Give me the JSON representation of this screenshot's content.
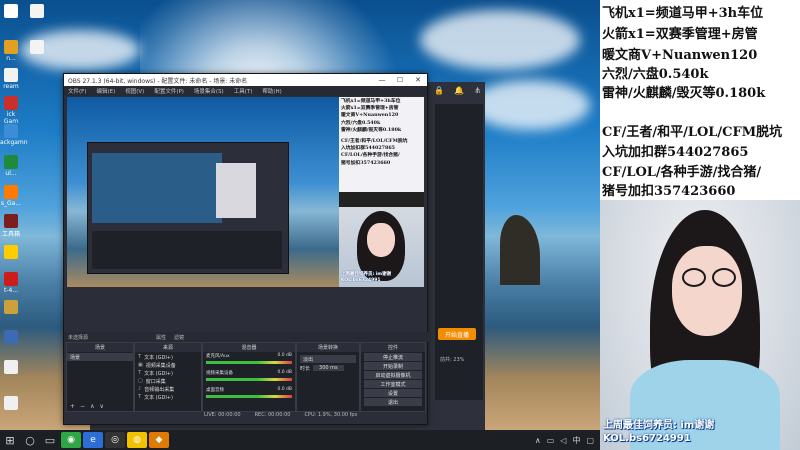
{
  "desktop": {
    "icons": [
      "n...",
      "ream",
      "ick Gam",
      "ackgamn",
      "ul...",
      "s_Ga...",
      "t-4...",
      "工具箱"
    ],
    "icons_right": [
      "",
      "",
      "",
      "",
      "",
      "",
      ""
    ]
  },
  "obs": {
    "title": "OBS 27.1.3 (64-bit, windows) - 配置文件: 未命名 - 场景: 未命名",
    "menu": [
      "文件(F)",
      "编辑(E)",
      "视图(V)",
      "配置文件(P)",
      "场景集合(S)",
      "工具(T)",
      "帮助(H)"
    ],
    "preview_text": [
      "飞机x1=频道马甲+3h车位",
      "火箭x1=双赛季管理+房管",
      "暖文商V+Nuanwen120",
      "六烈/六盘0.540k",
      "雷神/火麒麟/毁灭等0.180k",
      "CF/王者/和平/LOL/CFM脱坑",
      "入坑加扣群544027865",
      "CF/LOL/各种手游/找合猪/",
      "猪号加扣357423660"
    ],
    "preview_caption": "上周最佳饲养员: im谢谢",
    "preview_caption2": "KOL.bs6724991",
    "status_bar": "未选择源",
    "status_props": "属性",
    "status_filters": "滤镜",
    "panels": {
      "scenes": "场景",
      "sources": "来源",
      "mixer": "混音器",
      "transitions": "场景转换",
      "controls": "控件"
    },
    "scene_item": "场景",
    "sources": [
      "文本 (GDI+)",
      "视频采集设备",
      "文本 (GDI+)",
      "窗口采集",
      "音频输出采集",
      "文本 (GDI+)"
    ],
    "mixer_tracks": [
      "麦克风/Aux",
      "视频采集设备",
      "桌面音频"
    ],
    "mixer_values": [
      "0.0 dB",
      "0.0 dB",
      "0.0 dB"
    ],
    "transition": {
      "type": "淡出",
      "duration_label": "时长",
      "duration": "300 ms"
    },
    "controls": [
      "停止推流",
      "开始录制",
      "启动虚拟摄像机",
      "工作室模式",
      "设置",
      "退出"
    ],
    "footer": {
      "live": "LIVE: 00:00:00",
      "rec": "REC: 00:00:00",
      "cpu": "CPU: 1.9%, 30.00 fps"
    },
    "side_button": "开始直播",
    "side_status": "前共: 23%"
  },
  "taskbar": {
    "time": "",
    "apps": [
      "WeChat",
      "Edge",
      "OBS",
      "Chrome",
      "Game"
    ]
  },
  "overlay": {
    "lines": [
      "飞机x1=频道马甲+3h车位",
      "火箭x1=双赛季管理+房管",
      "暖文商V+Nuanwen120",
      "六烈/六盘0.540k",
      "雷神/火麒麟/毁灭等0.180k",
      "CF/王者/和平/LOL/CFM脱坑",
      "入坑加扣群544027865",
      "CF/LOL/各种手游/找合猪/",
      "猪号加扣357423660"
    ],
    "caption1": "上周最佳饲养员: im谢谢",
    "caption2": "KOL.bs6724991"
  }
}
